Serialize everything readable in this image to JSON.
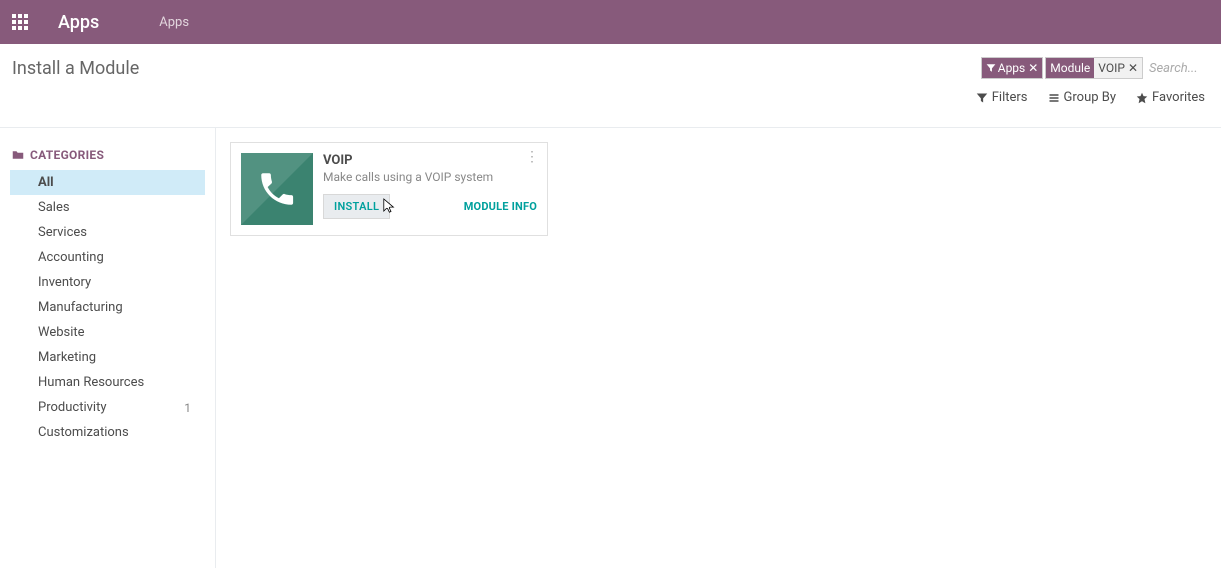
{
  "header": {
    "app_title": "Apps",
    "breadcrumb": "Apps"
  },
  "page": {
    "title": "Install a Module"
  },
  "search": {
    "placeholder": "Search...",
    "tags": [
      {
        "prefix_label": "",
        "value_label": "Apps",
        "has_prefix_icon": true
      },
      {
        "prefix_label": "Module",
        "value_label": "VOIP",
        "has_prefix_icon": false
      }
    ]
  },
  "toolbar": {
    "filters": "Filters",
    "group_by": "Group By",
    "favorites": "Favorites"
  },
  "sidebar": {
    "title": "CATEGORIES",
    "items": [
      {
        "label": "All",
        "count": "",
        "active": true
      },
      {
        "label": "Sales",
        "count": ""
      },
      {
        "label": "Services",
        "count": ""
      },
      {
        "label": "Accounting",
        "count": ""
      },
      {
        "label": "Inventory",
        "count": ""
      },
      {
        "label": "Manufacturing",
        "count": ""
      },
      {
        "label": "Website",
        "count": ""
      },
      {
        "label": "Marketing",
        "count": ""
      },
      {
        "label": "Human Resources",
        "count": ""
      },
      {
        "label": "Productivity",
        "count": "1"
      },
      {
        "label": "Customizations",
        "count": ""
      }
    ]
  },
  "modules": [
    {
      "name": "VOIP",
      "description": "Make calls using a VOIP system",
      "install_label": "INSTALL",
      "info_label": "MODULE INFO",
      "icon": "phone-icon"
    }
  ]
}
